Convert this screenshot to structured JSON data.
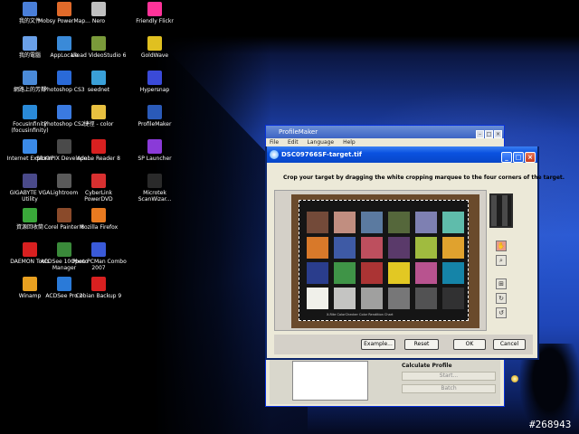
{
  "watermark": "#268943",
  "desktop_icons": [
    {
      "label": "我的文件",
      "icon": "folder-documents-icon",
      "color": "#4a7fd9"
    },
    {
      "label": "Mobsy PowerMap...",
      "icon": "app-icon",
      "color": "#e06a2a"
    },
    {
      "label": "Nero",
      "icon": "nero-icon",
      "color": "#c0c0c0"
    },
    {
      "label": "Friendly Flickr",
      "icon": "flickr-icon",
      "color": "#ff3399"
    },
    {
      "label": "我的電腦",
      "icon": "computer-icon",
      "color": "#6aa0e8"
    },
    {
      "label": "AppLocale",
      "icon": "globe-icon",
      "color": "#3a8ad8"
    },
    {
      "label": "Ulead VideoStudio 6",
      "icon": "video-icon",
      "color": "#7a9a3a"
    },
    {
      "label": "GoldWave",
      "icon": "audio-icon",
      "color": "#e0c020"
    },
    {
      "label": "網路上的芳鄰",
      "icon": "network-icon",
      "color": "#4a8ad8"
    },
    {
      "label": "Photoshop CS3",
      "icon": "photoshop-icon",
      "color": "#2a6ad8"
    },
    {
      "label": "seednet",
      "icon": "seednet-icon",
      "color": "#3aa0d8"
    },
    {
      "label": "Hypersnap",
      "icon": "camera-icon",
      "color": "#3a4ad8"
    },
    {
      "label": "FocusInfinity (focusinfinity)",
      "icon": "app-icon",
      "color": "#2a8ad8"
    },
    {
      "label": "Photoshop CS2",
      "icon": "photoshop-icon",
      "color": "#3a7ae0"
    },
    {
      "label": "捷徑 - color",
      "icon": "folder-icon",
      "color": "#e8c040"
    },
    {
      "label": "ProfileMaker",
      "icon": "profilemaker-icon",
      "color": "#2a5ab8"
    },
    {
      "label": "Internet Explorer",
      "icon": "ie-icon",
      "color": "#3a8ae8"
    },
    {
      "label": "SILKYPIX Develope...",
      "icon": "silkypix-icon",
      "color": "#4a4a4a"
    },
    {
      "label": "Adobe Reader 8",
      "icon": "pdf-icon",
      "color": "#d82020"
    },
    {
      "label": "SP Launcher",
      "icon": "launcher-icon",
      "color": "#8a3ad8"
    },
    {
      "label": "GIGABYTE VGA Utility",
      "icon": "gigabyte-icon",
      "color": "#4a4a8a"
    },
    {
      "label": "Lightroom",
      "icon": "lightroom-icon",
      "color": "#5a5a5a"
    },
    {
      "label": "CyberLink PowerDVD",
      "icon": "dvd-icon",
      "color": "#d83030"
    },
    {
      "label": "Microtek ScanWizar...",
      "icon": "scanner-icon",
      "color": "#2a2a2a"
    },
    {
      "label": "資源回收筒",
      "icon": "recycle-bin-icon",
      "color": "#3aa83a"
    },
    {
      "label": "Corel Painter 8",
      "icon": "painter-icon",
      "color": "#8a4a2a"
    },
    {
      "label": "Mozilla Firefox",
      "icon": "firefox-icon",
      "color": "#e87a20"
    },
    {
      "label": "DAEMON Tools",
      "icon": "daemon-icon",
      "color": "#d82020"
    },
    {
      "label": "ACDSee 10 Photo Manager",
      "icon": "acdsee-icon",
      "color": "#3a8a3a"
    },
    {
      "label": "Open PCMan Combo 2007",
      "icon": "pcman-icon",
      "color": "#3a5ad8"
    },
    {
      "label": "Winamp",
      "icon": "winamp-icon",
      "color": "#e8a020"
    },
    {
      "label": "ACDSee Pro 2",
      "icon": "acdsee-icon",
      "color": "#2a7ad8"
    },
    {
      "label": "Cobian Backup 9",
      "icon": "cobian-icon",
      "color": "#d82020"
    }
  ],
  "profilemaker": {
    "title": "ProfileMaker",
    "menu": [
      "File",
      "Edit",
      "Language",
      "Help"
    ],
    "calc_title": "Calculate Profile",
    "start_label": "Start...",
    "batch_label": "Batch"
  },
  "dialog": {
    "title": "DSC09766SF-target.tif",
    "instruction": "Crop your target by dragging the white cropping marquee to the four corners of the target.",
    "chart_footer": "X-Rite ColorChecker Color Rendition Chart",
    "buttons": {
      "example": "Example...",
      "reset": "Reset",
      "ok": "OK",
      "cancel": "Cancel"
    }
  },
  "color_patches": [
    [
      "#734a39",
      "#c18e80",
      "#5b7aa0",
      "#55673b",
      "#7e80b2",
      "#5fbcab"
    ],
    [
      "#d8792a",
      "#3e5aa5",
      "#bd4f5e",
      "#5a3a6a",
      "#a0bb3f",
      "#e0a22e"
    ],
    [
      "#2a3d8c",
      "#3f9447",
      "#ab3434",
      "#e2c823",
      "#b8538f",
      "#1584a8"
    ],
    [
      "#f0f0ea",
      "#c4c4c2",
      "#a0a09f",
      "#777778",
      "#525253",
      "#313132"
    ]
  ]
}
